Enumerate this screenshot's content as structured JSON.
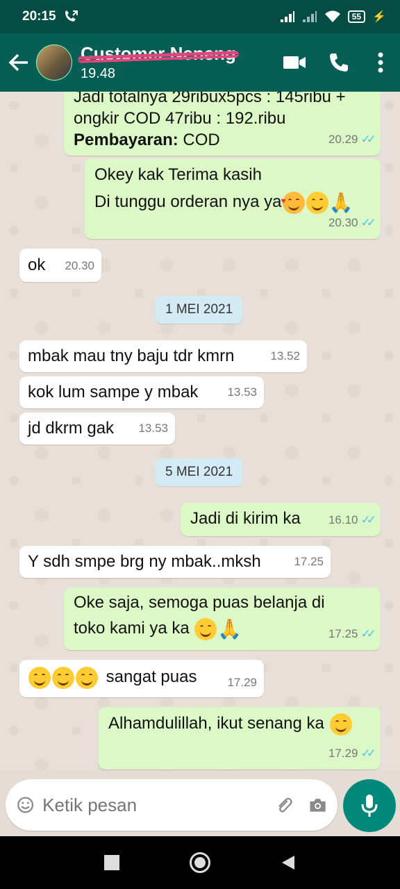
{
  "status": {
    "time": "20:15",
    "battery": "55"
  },
  "header": {
    "contact_name": "Customer Neneng",
    "subtitle": "19.48"
  },
  "messages": [
    {
      "line1": "Jadi totalnya 29ribux5pcs : 145ribu +",
      "line2": "ongkir COD 47ribu : 192.ribu",
      "line3_bold": "Pembayaran:",
      "line3_rest": " COD",
      "time": "20.29"
    },
    {
      "line1": "Okey kak Terima kasih",
      "line2": "Di tunggu orderan nya ya",
      "time": "20.30"
    },
    {
      "text": "ok",
      "time": "20.30"
    },
    {
      "date": "1 MEI 2021"
    },
    {
      "text": "mbak  mau tny baju tdr kmrn",
      "time": "13.52"
    },
    {
      "text": "kok lum sampe y mbak",
      "time": "13.53"
    },
    {
      "text": "jd dkrm gak",
      "time": "13.53"
    },
    {
      "date": "5 MEI 2021"
    },
    {
      "text": "Jadi di kirim ka",
      "time": "16.10"
    },
    {
      "text": "Y sdh smpe brg ny mbak..mksh",
      "time": "17.25"
    },
    {
      "line1": "Oke saja, semoga puas belanja di",
      "line2": "toko kami ya ka",
      "time": "17.25"
    },
    {
      "text": "sangat puas",
      "time": "17.29"
    },
    {
      "text": "Alhamdulillah, ikut senang ka",
      "time": "17.29"
    }
  ],
  "input": {
    "placeholder": "Ketik pesan"
  },
  "colors": {
    "header": "#075e54",
    "outgoing": "#dcf8c6",
    "incoming": "#ffffff",
    "read_ticks": "#4fc3f7",
    "mic": "#00897b"
  }
}
